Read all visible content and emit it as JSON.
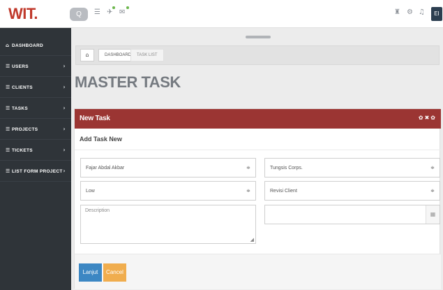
{
  "brand": {
    "logo": "WIT."
  },
  "topbar": {
    "search_icon": "Q",
    "left_icons": [
      "☰",
      "✈",
      "✉"
    ],
    "right_icons": [
      "♜",
      "⚙",
      "♫"
    ],
    "avatar_initials": "EI"
  },
  "sidebar": {
    "items": [
      {
        "icon": "⌂",
        "label": "DASHBOARD",
        "chevron": ""
      },
      {
        "icon": "☰",
        "label": "USERS",
        "chevron": "›"
      },
      {
        "icon": "☰",
        "label": "CLIENTS",
        "chevron": "›"
      },
      {
        "icon": "☰",
        "label": "TASKS",
        "chevron": "›"
      },
      {
        "icon": "☰",
        "label": "PROJECTS",
        "chevron": "›"
      },
      {
        "icon": "☰",
        "label": "TICKETS",
        "chevron": "›"
      },
      {
        "icon": "☰",
        "label": "LIST FORM PROJECT",
        "chevron": "›"
      }
    ]
  },
  "breadcrumb": {
    "home_icon": "⌂",
    "items": [
      "DASHBOARD",
      "TASK LIST"
    ]
  },
  "page": {
    "title": "MASTER TASK"
  },
  "panel": {
    "title": "New Task",
    "tools": "✿✖✿",
    "subtitle": "Add Task New"
  },
  "form": {
    "assignee": "Fajar Abdal Akbar",
    "client": "Tungsis Corps.",
    "priority": "Low",
    "type": "Revisi Client",
    "description_placeholder": "Description",
    "date_value": "",
    "caret": "≑",
    "calendar_icon": "▦",
    "resize_icon": "◢"
  },
  "buttons": {
    "submit": "Lanjut",
    "cancel": "Cancel"
  },
  "colors": {
    "brand": "#c0392b",
    "panel_header": "#9b3533",
    "primary": "#3c87c3",
    "warning": "#f0ad4e",
    "sidebar": "#2f3439"
  }
}
